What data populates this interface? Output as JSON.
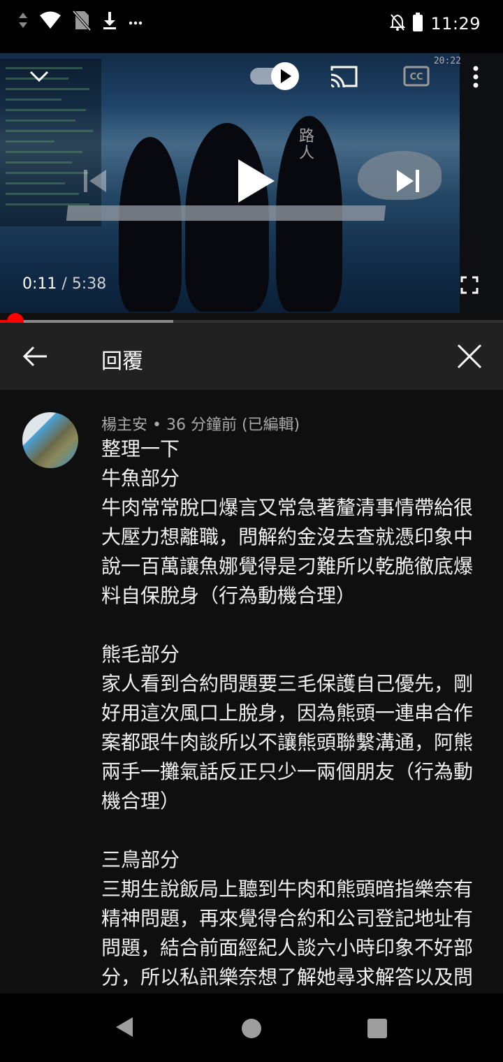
{
  "status_bar": {
    "time": "11:29",
    "icons": [
      "data-arrows-icon",
      "wifi-icon",
      "no-sim-icon",
      "download-icon",
      "more-notifications-icon",
      "mute-bell-icon",
      "battery-icon"
    ]
  },
  "player": {
    "current_time": "0:11",
    "separator": " / ",
    "duration": "5:38",
    "progress_fraction": 0.031,
    "buffered_fraction": 0.345,
    "overlay_corner_text": "20:22",
    "sign_text": "路\n人",
    "autoplay_on": true,
    "icons": {
      "collapse": "chevron-down-icon",
      "autoplay": "autoplay-toggle-icon",
      "cast": "cast-icon",
      "captions": "closed-captions-icon",
      "more": "more-vert-icon",
      "previous": "skip-previous-icon",
      "play": "play-icon",
      "next": "skip-next-icon",
      "fullscreen": "fullscreen-icon"
    }
  },
  "reply_panel": {
    "title": "回覆",
    "back_icon": "back-arrow-icon",
    "close_icon": "close-icon"
  },
  "comment": {
    "author": "楊主安",
    "dot": " • ",
    "posted": "36 分鐘前 (已編輯)",
    "body": "整理一下\n牛魚部分\n牛肉常常脫口爆言又常急著釐清事情帶給很大壓力想離職，問解約金沒去查就憑印象中說一百萬讓魚娜覺得是刁難所以乾脆徹底爆料自保脫身（行為動機合理）\n\n熊毛部分\n家人看到合約問題要三毛保護自己優先，剛好用這次風口上脫身，因為熊頭一連串合作案都跟牛肉談所以不讓熊頭聯繫溝通，阿熊兩手一攤氣話反正只少一兩個朋友（行為動機合理）\n\n三鳥部分\n三期生說飯局上聽到牛肉和熊頭暗指樂奈有精神問題，再來覺得合約和公司登記地址有問題，結合前面經紀人談六小時印象不好部分，所以私訊樂奈想了解她尋求解答以及問有沒有和熊頭不合，結合之前自稱老闆事情"
  },
  "nav_bar": {
    "icons": [
      "back-triangle-icon",
      "home-circle-icon",
      "recents-square-icon"
    ]
  },
  "colors": {
    "accent_red": "#ff0000",
    "panel_bg": "#212121",
    "page_bg": "#0f0f0f",
    "meta_text": "#aaaaaa"
  }
}
